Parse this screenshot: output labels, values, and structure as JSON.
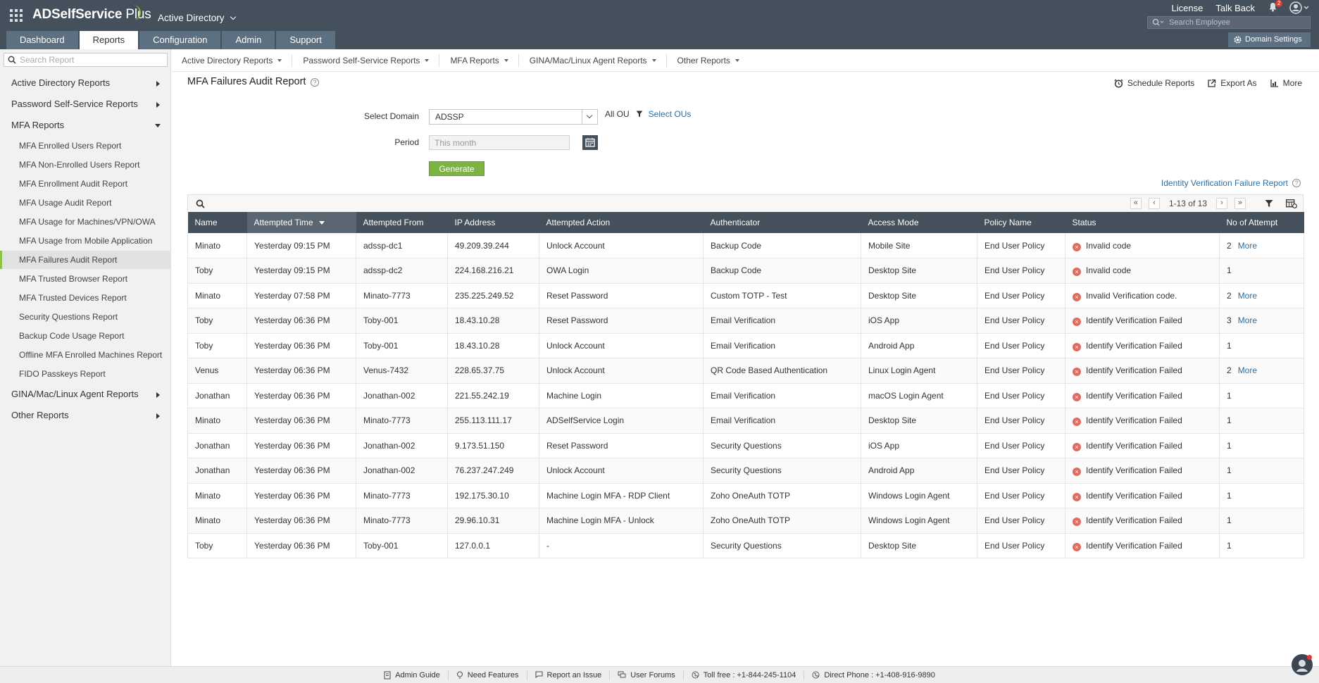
{
  "header": {
    "logo_main": "ADSelfService",
    "logo_plus": " Plus",
    "product": "Active Directory",
    "links": [
      "License",
      "Talk Back"
    ],
    "notification_count": "2",
    "employee_search_placeholder": "Search Employee",
    "tabs": [
      "Dashboard",
      "Reports",
      "Configuration",
      "Admin",
      "Support"
    ],
    "active_tab": "Reports",
    "domain_settings_label": "Domain Settings"
  },
  "sidebar": {
    "search_placeholder": "Search Report",
    "categories": [
      "Active Directory Reports",
      "Password Self-Service Reports",
      "MFA Reports",
      "GINA/Mac/Linux Agent Reports",
      "Other Reports"
    ],
    "mfa_items": [
      "MFA Enrolled Users Report",
      "MFA Non-Enrolled Users Report",
      "MFA Enrollment Audit Report",
      "MFA Usage Audit Report",
      "MFA Usage for Machines/VPN/OWA",
      "MFA Usage from Mobile Application",
      "MFA Failures Audit Report",
      "MFA Trusted Browser Report",
      "MFA Trusted Devices Report",
      "Security Questions Report",
      "Backup Code Usage Report",
      "Offline MFA Enrolled Machines Report",
      "FIDO Passkeys Report"
    ],
    "active_item": "MFA Failures Audit Report"
  },
  "subnav": [
    "Active Directory Reports",
    "Password Self-Service Reports",
    "MFA Reports",
    "GINA/Mac/Linux Agent Reports",
    "Other Reports"
  ],
  "report": {
    "title": "MFA Failures Audit Report",
    "help_symbol": "?",
    "actions": [
      "Schedule Reports",
      "Export As",
      "More"
    ],
    "form": {
      "domain_label": "Select Domain",
      "domain_value": "ADSSP",
      "ou_text": "All OU",
      "select_ous": "Select OUs",
      "period_label": "Period",
      "period_placeholder": "This month",
      "generate_label": "Generate"
    },
    "ivf_link": "Identity Verification Failure Report",
    "pager": {
      "first": "«",
      "prev": "‹",
      "next": "›",
      "last": "»",
      "count": "1-13 of 13"
    }
  },
  "table": {
    "columns": [
      "Name",
      "Attempted Time",
      "Attempted From",
      "IP Address",
      "Attempted Action",
      "Authenticator",
      "Access Mode",
      "Policy Name",
      "Status",
      "No of Attempt"
    ],
    "sorted_column": "Attempted Time",
    "more_label": "More",
    "rows": [
      {
        "name": "Minato",
        "time": "Yesterday 09:15 PM",
        "from": "adssp-dc1",
        "ip": "49.209.39.244",
        "action": "Unlock Account",
        "auth": "Backup Code",
        "mode": "Mobile Site",
        "policy": "End User Policy",
        "status": "Invalid code",
        "attempts": "2",
        "more": true
      },
      {
        "name": "Toby",
        "time": "Yesterday 09:15 PM",
        "from": "adssp-dc2",
        "ip": "224.168.216.21",
        "action": "OWA Login",
        "auth": "Backup Code",
        "mode": "Desktop Site",
        "policy": "End User Policy",
        "status": "Invalid code",
        "attempts": "1",
        "more": false
      },
      {
        "name": "Minato",
        "time": "Yesterday 07:58 PM",
        "from": "Minato-7773",
        "ip": "235.225.249.52",
        "action": "Reset Password",
        "auth": "Custom TOTP - Test",
        "mode": "Desktop Site",
        "policy": "End User Policy",
        "status": "Invalid Verification code.",
        "attempts": "2",
        "more": true
      },
      {
        "name": "Toby",
        "time": "Yesterday 06:36 PM",
        "from": "Toby-001",
        "ip": "18.43.10.28",
        "action": "Reset Password",
        "auth": "Email Verification",
        "mode": "iOS App",
        "policy": "End User Policy",
        "status": "Identify Verification Failed",
        "attempts": "3",
        "more": true
      },
      {
        "name": "Toby",
        "time": "Yesterday 06:36 PM",
        "from": "Toby-001",
        "ip": "18.43.10.28",
        "action": "Unlock Account",
        "auth": "Email Verification",
        "mode": "Android App",
        "policy": "End User Policy",
        "status": "Identify Verification Failed",
        "attempts": "1",
        "more": false
      },
      {
        "name": "Venus",
        "time": "Yesterday 06:36 PM",
        "from": "Venus-7432",
        "ip": "228.65.37.75",
        "action": "Unlock Account",
        "auth": "QR Code Based Authentication",
        "mode": "Linux Login Agent",
        "policy": "End User Policy",
        "status": "Identify Verification Failed",
        "attempts": "2",
        "more": true
      },
      {
        "name": "Jonathan",
        "time": "Yesterday 06:36 PM",
        "from": "Jonathan-002",
        "ip": "221.55.242.19",
        "action": "Machine Login",
        "auth": "Email Verification",
        "mode": "macOS Login Agent",
        "policy": "End User Policy",
        "status": "Identify Verification Failed",
        "attempts": "1",
        "more": false
      },
      {
        "name": "Minato",
        "time": "Yesterday 06:36 PM",
        "from": "Minato-7773",
        "ip": "255.113.111.17",
        "action": "ADSelfService Login",
        "auth": "Email Verification",
        "mode": "Desktop Site",
        "policy": "End User Policy",
        "status": "Identify Verification Failed",
        "attempts": "1",
        "more": false
      },
      {
        "name": "Jonathan",
        "time": "Yesterday 06:36 PM",
        "from": "Jonathan-002",
        "ip": "9.173.51.150",
        "action": "Reset Password",
        "auth": "Security Questions",
        "mode": "iOS App",
        "policy": "End User Policy",
        "status": "Identify Verification Failed",
        "attempts": "1",
        "more": false
      },
      {
        "name": "Jonathan",
        "time": "Yesterday 06:36 PM",
        "from": "Jonathan-002",
        "ip": "76.237.247.249",
        "action": "Unlock Account",
        "auth": "Security Questions",
        "mode": "Android App",
        "policy": "End User Policy",
        "status": "Identify Verification Failed",
        "attempts": "1",
        "more": false
      },
      {
        "name": "Minato",
        "time": "Yesterday 06:36 PM",
        "from": "Minato-7773",
        "ip": "192.175.30.10",
        "action": "Machine Login MFA - RDP Client",
        "auth": "Zoho OneAuth TOTP",
        "mode": "Windows Login Agent",
        "policy": "End User Policy",
        "status": "Identify Verification Failed",
        "attempts": "1",
        "more": false
      },
      {
        "name": "Minato",
        "time": "Yesterday 06:36 PM",
        "from": "Minato-7773",
        "ip": "29.96.10.31",
        "action": "Machine Login MFA - Unlock",
        "auth": "Zoho OneAuth TOTP",
        "mode": "Windows Login Agent",
        "policy": "End User Policy",
        "status": "Identify Verification Failed",
        "attempts": "1",
        "more": false
      },
      {
        "name": "Toby",
        "time": "Yesterday 06:36 PM",
        "from": "Toby-001",
        "ip": "127.0.0.1",
        "action": "-",
        "auth": "Security Questions",
        "mode": "Desktop Site",
        "policy": "End User Policy",
        "status": "Identify Verification Failed",
        "attempts": "1",
        "more": false
      }
    ]
  },
  "footer": [
    "Admin Guide",
    "Need Features",
    "Report an Issue",
    "User Forums",
    "Toll free : +1-844-245-1104",
    "Direct Phone : +1-408-916-9890"
  ],
  "colors": {
    "header_bg": "#44505c",
    "tab_bg": "#5d7082",
    "accent_green": "#7cb342",
    "link_blue": "#2d6fa3",
    "status_error": "#e06b61"
  }
}
